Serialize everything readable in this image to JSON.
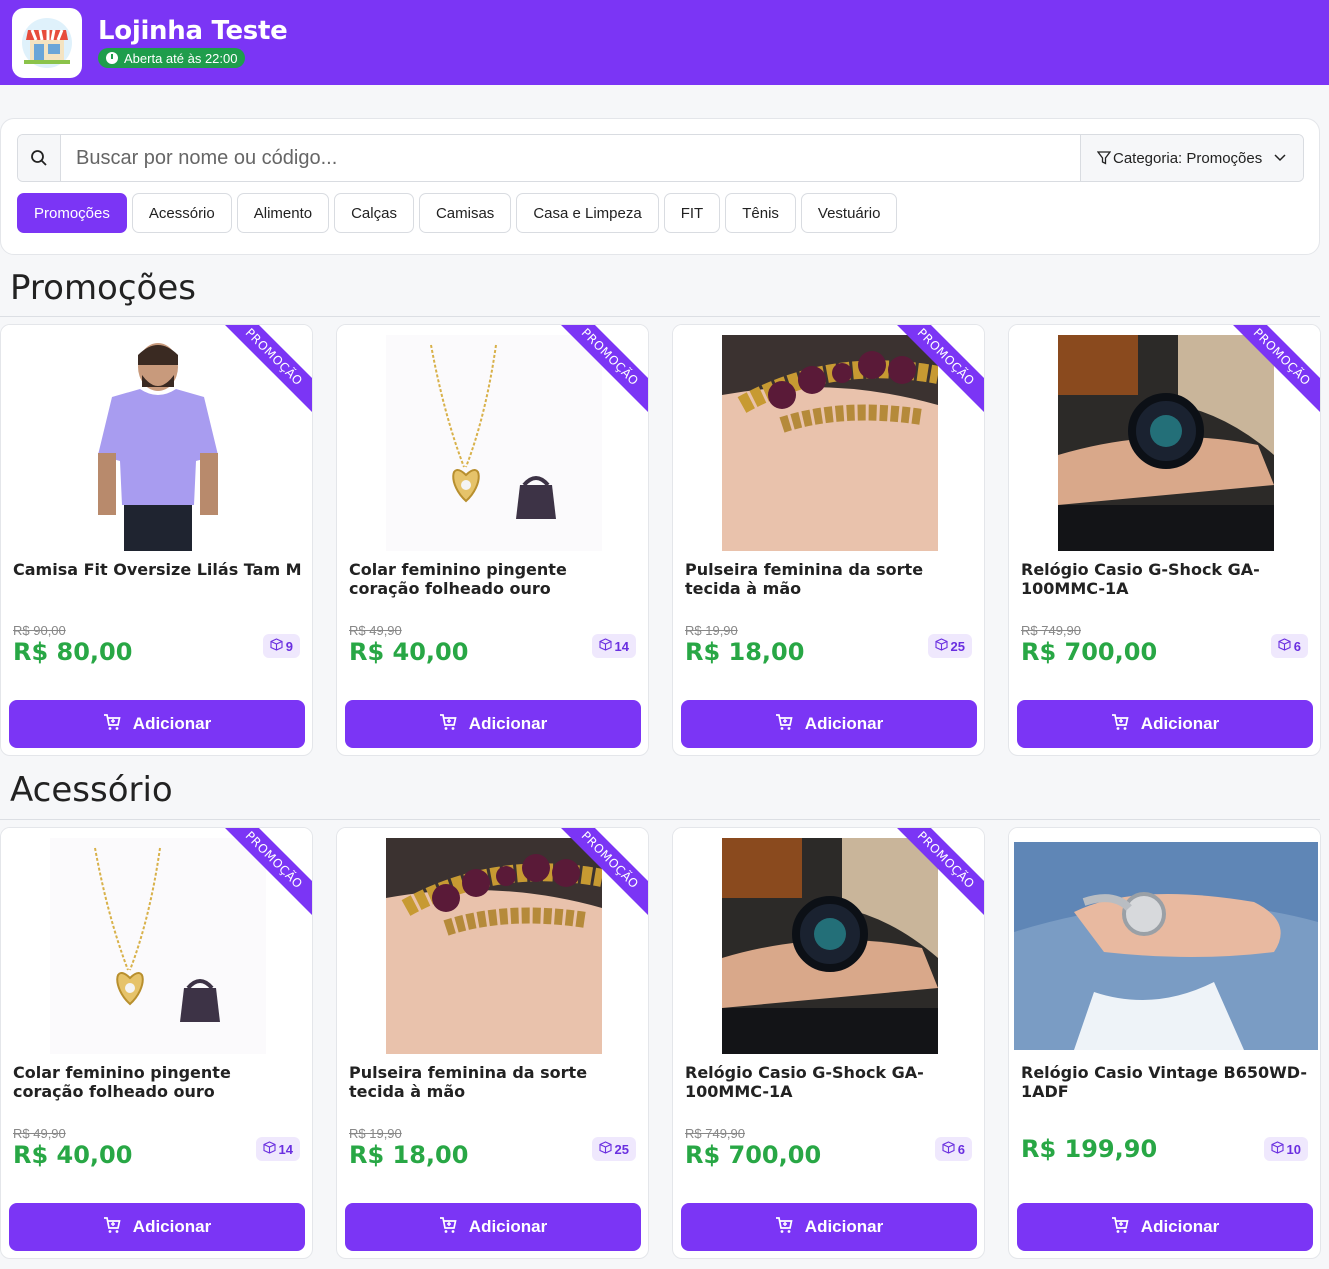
{
  "store": {
    "name": "Lojinha Teste",
    "status": "Aberta até às 22:00",
    "brand_color": "#7b35f5",
    "status_color": "#1f9d4c"
  },
  "search": {
    "placeholder": "Buscar por nome ou código...",
    "category_label": "Categoria: Promoções"
  },
  "categories": [
    "Promoções",
    "Acessório",
    "Alimento",
    "Calças",
    "Camisas",
    "Casa e Limpeza",
    "FIT",
    "Tênis",
    "Vestuário"
  ],
  "ribbon_label": "PROMOÇÃO",
  "add_label": "Adicionar",
  "price_color": "#28a745",
  "sections": [
    {
      "title": "Promoções",
      "products": [
        {
          "name": "Camisa Fit Oversize Lilás Tam M",
          "old_price": "R$ 90,00",
          "price": "R$ 80,00",
          "stock": "9",
          "image": "shirt"
        },
        {
          "name": "Colar feminino pingente coração folheado ouro",
          "old_price": "R$ 49,90",
          "price": "R$ 40,00",
          "stock": "14",
          "image": "necklace"
        },
        {
          "name": "Pulseira feminina da sorte tecida à mão",
          "old_price": "R$ 19,90",
          "price": "R$ 18,00",
          "stock": "25",
          "image": "bracelet"
        },
        {
          "name": "Relógio Casio G-Shock GA-100MMC-1A",
          "old_price": "R$ 749,90",
          "price": "R$ 700,00",
          "stock": "6",
          "image": "watch"
        }
      ]
    },
    {
      "title": "Acessório",
      "products": [
        {
          "name": "Colar feminino pingente coração folheado ouro",
          "old_price": "R$ 49,90",
          "price": "R$ 40,00",
          "stock": "14",
          "image": "necklace"
        },
        {
          "name": "Pulseira feminina da sorte tecida à mão",
          "old_price": "R$ 19,90",
          "price": "R$ 18,00",
          "stock": "25",
          "image": "bracelet"
        },
        {
          "name": "Relógio Casio G-Shock GA-100MMC-1A",
          "old_price": "R$ 749,90",
          "price": "R$ 700,00",
          "stock": "6",
          "image": "watch"
        },
        {
          "name": "Relógio Casio Vintage B650WD-1ADF",
          "old_price": "",
          "price": "R$ 199,90",
          "stock": "10",
          "image": "vintage-watch"
        }
      ]
    }
  ]
}
